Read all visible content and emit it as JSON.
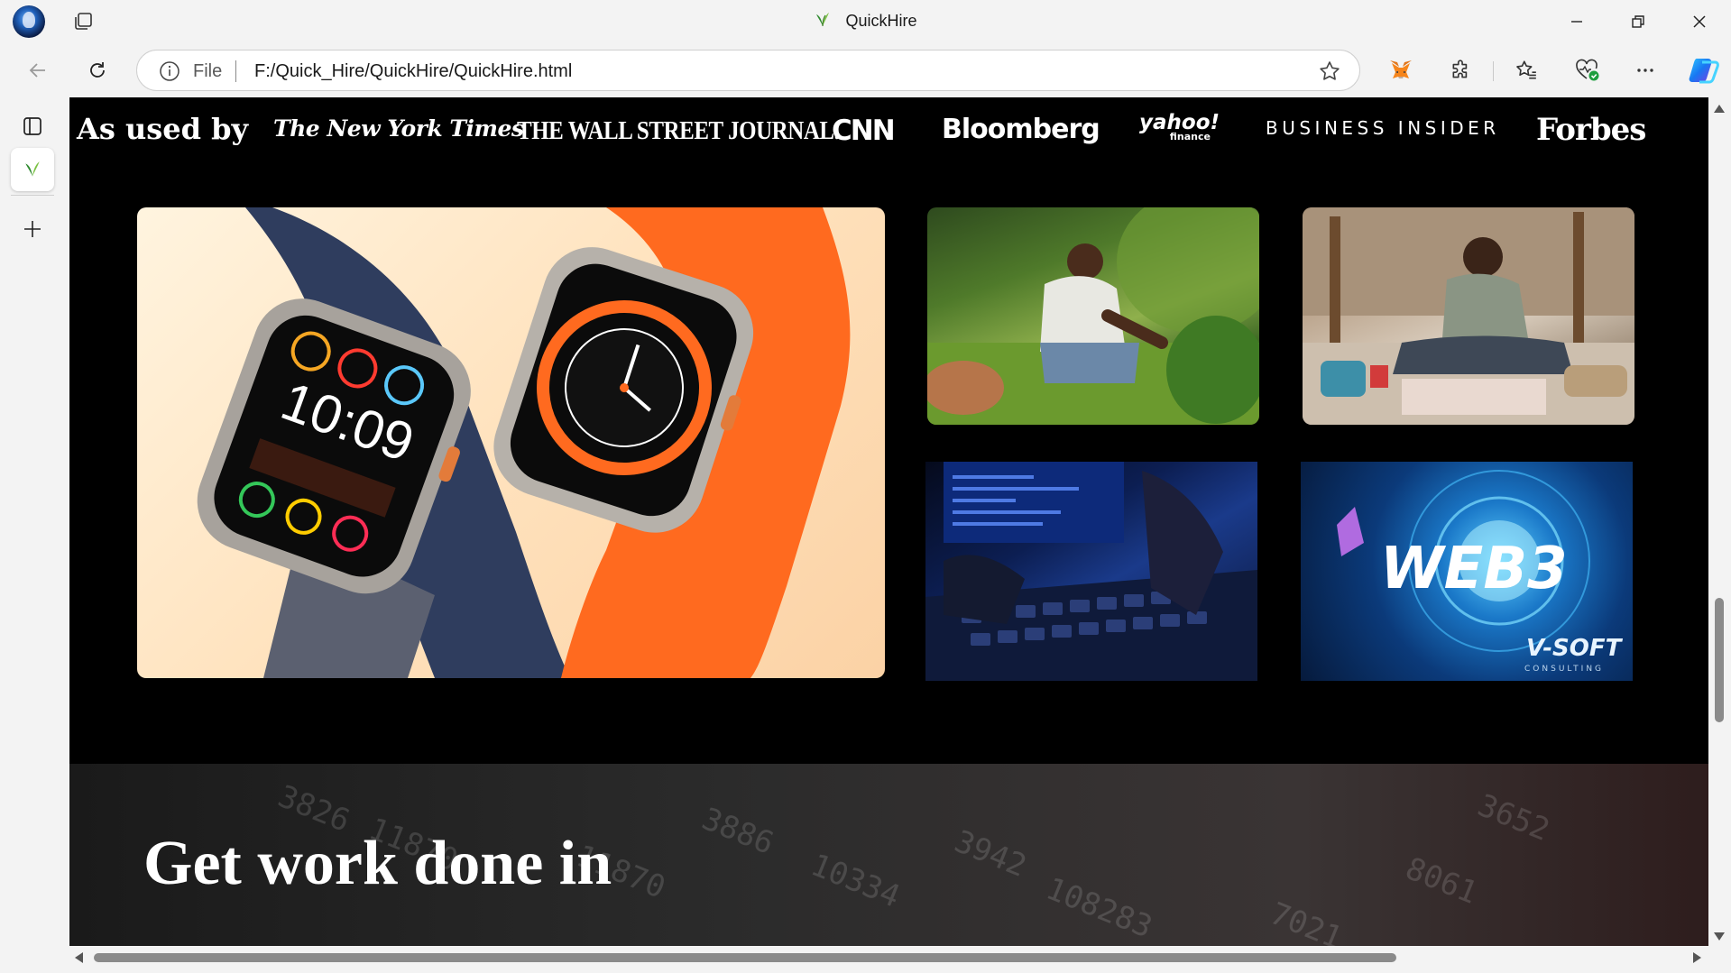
{
  "window": {
    "title": "QuickHire",
    "minimize_icon": "minimize-icon",
    "restore_icon": "restore-icon",
    "close_icon": "close-icon"
  },
  "addressbar": {
    "scheme_label": "File",
    "url": "F:/Quick_Hire/QuickHire/QuickHire.html"
  },
  "toolbar": {
    "icons": [
      "back-icon",
      "refresh-icon",
      "info-icon",
      "favorite-star-icon",
      "metamask-extension-icon",
      "extensions-icon",
      "favorites-icon",
      "browser-essentials-icon",
      "more-icon",
      "copilot-icon"
    ]
  },
  "sidebar": {
    "icons": [
      "tab-actions-icon",
      "quickhire-tab-icon",
      "new-tab-icon"
    ]
  },
  "page": {
    "as_used_by": "As used by",
    "press_logos": [
      "The New York Times",
      "THE WALL STREET JOURNAL.",
      "CNN",
      "Bloomberg",
      "yahoo!",
      "BUSINESS INSIDER",
      "Forbes"
    ],
    "yahoo_sub": "finance",
    "hero_watch_time": "10:09",
    "web3_text": "WEB3",
    "vsoft_text": "V-SOFT",
    "vsoft_sub": "CONSULTING",
    "headline": "Get work done in"
  },
  "colors": {
    "page_bg": "#000000",
    "chrome_bg": "#f3f3f3",
    "text_on_dark": "#ffffff",
    "orange_band": "#ff6a1f",
    "navy_band": "#2f3d5e"
  }
}
